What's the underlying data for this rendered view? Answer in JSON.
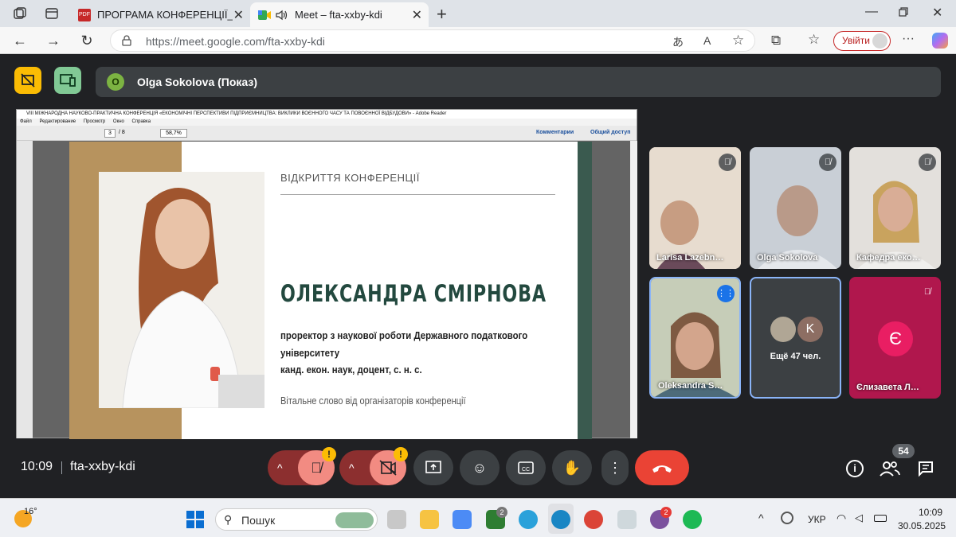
{
  "browser": {
    "tabs": [
      {
        "title": "ПРОГРАМА КОНФЕРЕНЦІЇ_Плена",
        "icon": "pdf-icon"
      },
      {
        "title": "Meet – fta-xxby-kdi",
        "icon": "meet-icon"
      }
    ],
    "url": "https://meet.google.com/fta-xxby-kdi",
    "url_host": "https://meet.google.com",
    "url_path": "/fta-xxby-kdi",
    "signin_label": "Увійти"
  },
  "meet": {
    "presenter_initial": "O",
    "presenter_label": "Olga Sokolova (Показ)",
    "time": "10:09",
    "meeting_code": "fta-xxby-kdi",
    "people_count": "54",
    "participants": [
      {
        "name": "Larisa Lazebn…",
        "muted": true
      },
      {
        "name": "Olga Sokolova",
        "muted": true
      },
      {
        "name": "Кафедра еко…",
        "muted": true
      },
      {
        "name": "Oleksandra S…",
        "muted": false,
        "speaking": true
      },
      {
        "name": "Ещё 47 чел.",
        "initial": "K"
      },
      {
        "name": "Єлизавета Л…",
        "initial": "Є",
        "muted": true
      }
    ]
  },
  "reader": {
    "title": "VIII МІЖНАРОДНА НАУКОВО-ПРАКТИЧНА КОНФЕРЕНЦІЯ «ЕКОНОМІЧНІ ПЕРСПЕКТИВИ ПІДПРИЄМНИЦТВА: ВИКЛИКИ ВОЄННОГО ЧАСУ ТА ПОВОЄННОЇ ВІДБУДОВИ» - Adobe Reader",
    "menu": [
      "Файл",
      "Редактирование",
      "Просмотр",
      "Окно",
      "Справка"
    ],
    "page_current": "3",
    "page_total": "/ 8",
    "zoom": "58,7%",
    "comments_label": "Комментарии",
    "share_label": "Общий доступ"
  },
  "slide": {
    "heading": "ВІДКРИТТЯ КОНФЕРЕНЦІЇ",
    "name": "ОЛЕКСАНДРА СМІРНОВА",
    "line1": "проректор з наукової роботи Державного податкового",
    "line2": "університету",
    "line3": "канд. екон. наук, доцент, с. н. с.",
    "footer": "Вітальне слово від організаторів конференції"
  },
  "taskbar": {
    "weather": "16°",
    "search_placeholder": "Пошук",
    "lang": "УКР",
    "time": "10:09",
    "date": "30.05.2025",
    "badge_xbox": "2",
    "badge_viber": "2"
  },
  "colors": {
    "meet_bg": "#202124",
    "control_bg": "#3c4043",
    "end_call": "#ea4335",
    "presenter_green": "#7cb342",
    "slide_name": "#23493f"
  }
}
